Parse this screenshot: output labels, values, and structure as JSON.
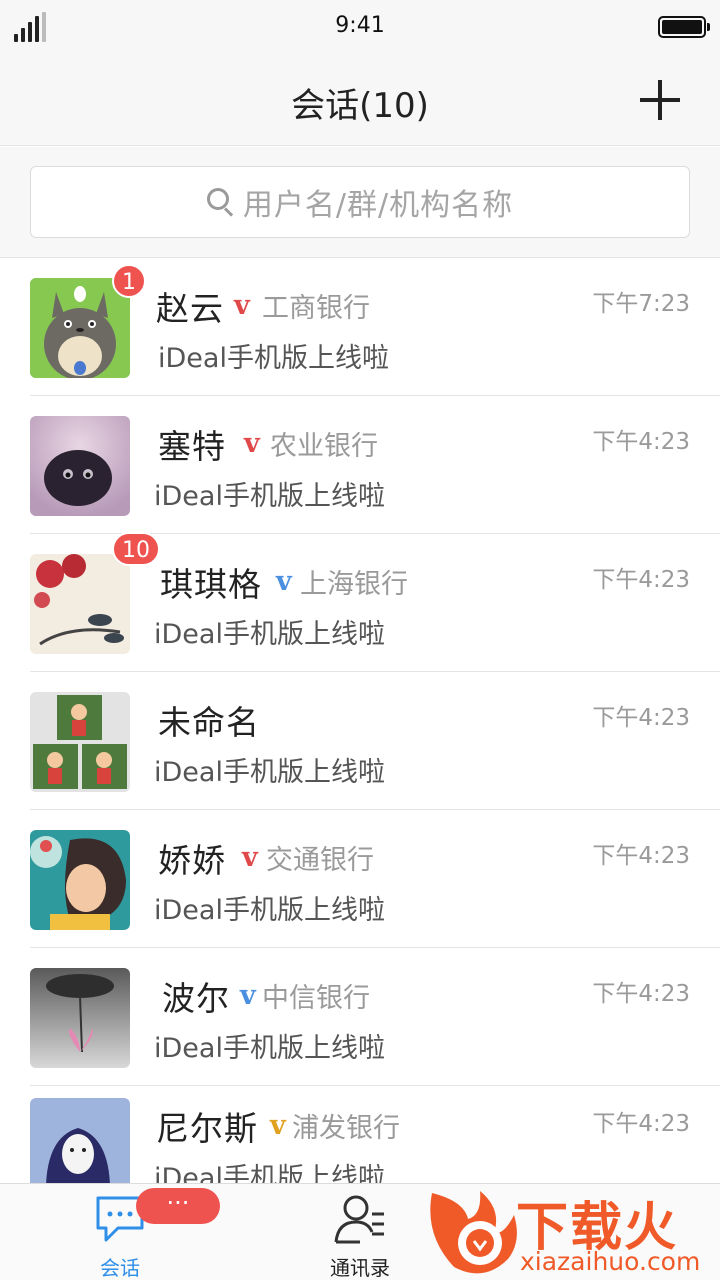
{
  "status_bar": {
    "time": "9:41"
  },
  "nav": {
    "title": "会话(10)",
    "add_icon": "plus-icon"
  },
  "search": {
    "placeholder": "用户名/群/机构名称",
    "icon": "search-icon"
  },
  "conversations": [
    {
      "name": "赵云",
      "v": "v",
      "v_color": "#e0484a",
      "org": "工商银行",
      "time": "下午7:23",
      "message": "iDeal手机版上线啦",
      "badge": "1"
    },
    {
      "name": "塞特",
      "v": "v",
      "v_color": "#e0484a",
      "org": "农业银行",
      "time": "下午4:23",
      "message": "iDeal手机版上线啦",
      "badge": ""
    },
    {
      "name": "琪琪格",
      "v": "v",
      "v_color": "#4a8fe0",
      "org": "上海银行",
      "time": "下午4:23",
      "message": "iDeal手机版上线啦",
      "badge": "10"
    },
    {
      "name": "未命名",
      "v": "",
      "v_color": "",
      "org": "",
      "time": "下午4:23",
      "message": "iDeal手机版上线啦",
      "badge": ""
    },
    {
      "name": "娇娇",
      "v": "v",
      "v_color": "#e0484a",
      "org": "交通银行",
      "time": "下午4:23",
      "message": "iDeal手机版上线啦",
      "badge": ""
    },
    {
      "name": "波尔",
      "v": "v",
      "v_color": "#4a8fe0",
      "org": "中信银行",
      "time": "下午4:23",
      "message": "iDeal手机版上线啦",
      "badge": ""
    },
    {
      "name": "尼尔斯",
      "v": "v",
      "v_color": "#e0a21e",
      "org": "浦发银行",
      "time": "下午4:23",
      "message": "iDeal手机版上线啦",
      "badge": ""
    }
  ],
  "tabs": [
    {
      "label": "会话",
      "icon": "chat-bubble-icon",
      "active": true,
      "badge": "···"
    },
    {
      "label": "通讯录",
      "icon": "contacts-icon",
      "active": false
    }
  ],
  "watermark": {
    "text": "下载火",
    "url": "xiazaihuo.com"
  },
  "colors": {
    "accent": "#2f8fe8",
    "badge": "#ef5350",
    "bar_bg": "#f7f7f7"
  }
}
